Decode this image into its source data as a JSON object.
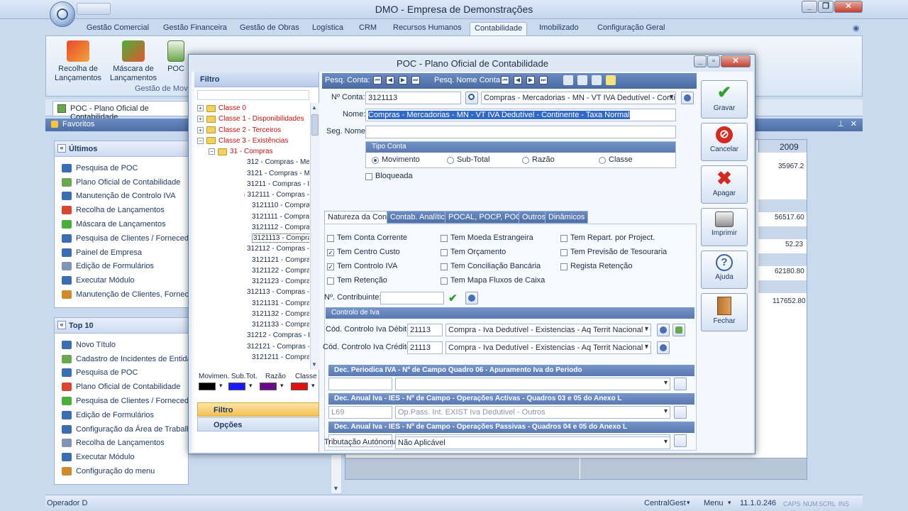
{
  "app": {
    "title": "DMO - Empresa de Demonstrações"
  },
  "ribbon": {
    "tabs": [
      "Gestão Comercial",
      "Gestão Financeira",
      "Gestão de Obras",
      "Logística",
      "CRM",
      "Recursos Humanos",
      "Contabilidade",
      "Imobilizado",
      "Configuração Geral"
    ],
    "active_tab": "Contabilidade",
    "buttons": [
      {
        "line1": "Recolha de",
        "line2": "Lançamentos"
      },
      {
        "line1": "Máscara de",
        "line2": "Lançamentos"
      },
      {
        "line1": "POC",
        "line2": ""
      }
    ],
    "group_label": "Gestão de Mov"
  },
  "doc_tab": {
    "label": "POC - Plano Oficial de Contabilidade"
  },
  "favorites_bar": {
    "label": "Favoritos"
  },
  "ultimos": {
    "title": "Últimos",
    "items": [
      "Pesquisa de POC",
      "Plano Oficial de Contabilidade",
      "Manutenção de Controlo IVA",
      "Recolha de Lançamentos",
      "Máscara de Lançamentos",
      "Pesquisa de Clientes / Fornecedores",
      "Painel de Empresa",
      "Edição de Formulários",
      "Executar Módulo",
      "Manutenção de Clientes, Fornecedores"
    ]
  },
  "top10": {
    "title": "Top 10",
    "items": [
      "Novo Título",
      "Cadastro de Incidentes de Entidade",
      "Pesquisa de POC",
      "Plano Oficial de Contabilidade",
      "Pesquisa de Clientes / Fornecedores",
      "Edição de Formulários",
      "Configuração da Área de Trabalho",
      "Recolha de Lançamentos",
      "Executar Módulo",
      "Configuração do menu"
    ]
  },
  "background_grid": {
    "year": "2009",
    "values": [
      "35967.2",
      "56517.60",
      "52.23",
      "62180.80",
      "117652.80"
    ]
  },
  "dialog": {
    "title": "POC - Plano Oficial de Contabilidade",
    "filter_header": "Filtro",
    "tree": [
      {
        "text": "Classe 0",
        "type": "folder",
        "red": true,
        "indent": 0,
        "exp": "+"
      },
      {
        "text": "Classe 1 - Disponibilidades",
        "type": "folder",
        "red": true,
        "indent": 0,
        "exp": "+"
      },
      {
        "text": "Classe 2 - Terceiros",
        "type": "folder",
        "red": true,
        "indent": 0,
        "exp": "+"
      },
      {
        "text": "Classe 3 - Existências",
        "type": "folder",
        "red": true,
        "indent": 0,
        "exp": "−"
      },
      {
        "text": "31 - Compras",
        "type": "folder",
        "red": true,
        "indent": 1,
        "exp": "−"
      },
      {
        "text": "312 - Compras - Me",
        "type": "arrow",
        "indent": 2
      },
      {
        "text": "3121 - Compras - M",
        "type": "arrow",
        "indent": 2
      },
      {
        "text": "31211 - Compras - I",
        "type": "arrow",
        "indent": 2
      },
      {
        "text": "312111 - Compras -",
        "type": "arrow",
        "indent": 2
      },
      {
        "text": "3121110 - Compras",
        "type": "diamond",
        "indent": 2
      },
      {
        "text": "3121111 - Compras",
        "type": "diamond",
        "indent": 2
      },
      {
        "text": "3121112 - Compras",
        "type": "diamond",
        "indent": 2
      },
      {
        "text": "3121113 - Compras",
        "type": "diamond",
        "indent": 2,
        "sel": true
      },
      {
        "text": "312112 - Compras -",
        "type": "arrow",
        "indent": 2
      },
      {
        "text": "3121121 - Compras",
        "type": "diamond",
        "indent": 2
      },
      {
        "text": "3121122 - Compras",
        "type": "diamond",
        "indent": 2
      },
      {
        "text": "3121123 - Compras",
        "type": "diamond",
        "indent": 2
      },
      {
        "text": "312113 - Compras -",
        "type": "arrow",
        "indent": 2
      },
      {
        "text": "3121131 - Compras",
        "type": "diamond",
        "indent": 2
      },
      {
        "text": "3121132 - Compras",
        "type": "diamond",
        "indent": 2
      },
      {
        "text": "3121133 - Compras",
        "type": "diamond",
        "indent": 2
      },
      {
        "text": "31212 - Compras - I",
        "type": "arrow",
        "indent": 2
      },
      {
        "text": "312121 - Compras -",
        "type": "arrow",
        "indent": 2
      },
      {
        "text": "3121211 - Compras",
        "type": "diamond",
        "indent": 2
      }
    ],
    "legend": {
      "labels": [
        "Movimen.",
        "Sub.Tot.",
        "Razão",
        "Classe"
      ],
      "colors": [
        "#000000",
        "#1a1aff",
        "#6a0a8a",
        "#e01010"
      ]
    },
    "nav_filtro": "Filtro",
    "nav_opcoes": "Opções",
    "toolstrip": {
      "pesq_conta": "Pesq. Conta:",
      "pesq_nome": "Pesq. Nome Conta:"
    },
    "form": {
      "no_conta_label": "Nº Conta:",
      "no_conta_value": "3121113",
      "conta_combo": "Compras - Mercadorias - MN - VT IVA Dedutível - Continente",
      "nome_label": "Nome:",
      "nome_value": "Compras - Mercadorias - MN - VT IVA Dedutível - Continente - Taxa Normal",
      "seg_nome_label": "Seg. Nome:",
      "tipo_conta_title": "Tipo Conta",
      "tipo_options": [
        "Movimento",
        "Sub-Total",
        "Razão",
        "Classe"
      ],
      "bloqueada_label": "Bloqueada"
    },
    "tabs": [
      "Natureza da Conta",
      "Contab. Analítica",
      "POCAL, POCP, POCE",
      "Outros",
      "Dinâmicos"
    ],
    "checks": [
      {
        "label": "Tem Conta Corrente",
        "on": false
      },
      {
        "label": "Tem Moeda Estrangeira",
        "on": false
      },
      {
        "label": "Tem Repart. por Project.",
        "on": false
      },
      {
        "label": "Tem Centro Custo",
        "on": true
      },
      {
        "label": "Tem Orçamento",
        "on": false
      },
      {
        "label": "Tem Previsão de Tesouraria",
        "on": false
      },
      {
        "label": "Tem Controlo IVA",
        "on": true
      },
      {
        "label": "Tem Conciliação Bancária",
        "on": false
      },
      {
        "label": "Regista Retenção",
        "on": false
      },
      {
        "label": "Tem Retenção",
        "on": false
      },
      {
        "label": "Tem Mapa Fluxos de Caixa",
        "on": false
      }
    ],
    "contribuinte_label": "Nº. Contribuinte:",
    "controlo_iva": {
      "title": "Controlo de Iva",
      "debito_label": "Cód. Controlo Iva Débito:",
      "debito_code": "21113",
      "debito_desc": "Compra - Iva Dedutível - Existencias - Aq Territ Nacional - Contin",
      "credito_label": "Cód. Controlo Iva Crédito:",
      "credito_code": "21113",
      "credito_desc": "Compra - Iva Dedutível - Existencias - Aq Territ Nacional - Contin"
    },
    "sections": [
      {
        "title": "Dec. Periodica IVA - Nº de Campo Quadro 06 - Apuramento Iva do Periodo",
        "code": "",
        "desc": ""
      },
      {
        "title": "Dec. Anual Iva - IES - Nº de Campo - Operações Activas - Quadros 03 e 05 do Anexo L",
        "code": "L69",
        "desc": "Op.Pass. Int. EXIST Iva Dedutivel - Outros"
      },
      {
        "title": "Dec. Anual Iva - IES - Nº de Campo - Operações Passivas - Quadros 04 e 05 do Anexo L",
        "code": "",
        "desc": ""
      }
    ],
    "tributacao_label": "Tributação Autónoma:",
    "tributacao_value": "Não Aplicável",
    "actions": [
      "Gravar",
      "Cancelar",
      "Apagar",
      "Imprimir",
      "Ajuda",
      "Fechar"
    ]
  },
  "status": {
    "operator": "Operador D",
    "server": "CentralGest",
    "menu": "Menu",
    "version": "11.1.0.246",
    "keys": [
      "CAPS",
      "NUM",
      "SCRL",
      "INS"
    ]
  }
}
